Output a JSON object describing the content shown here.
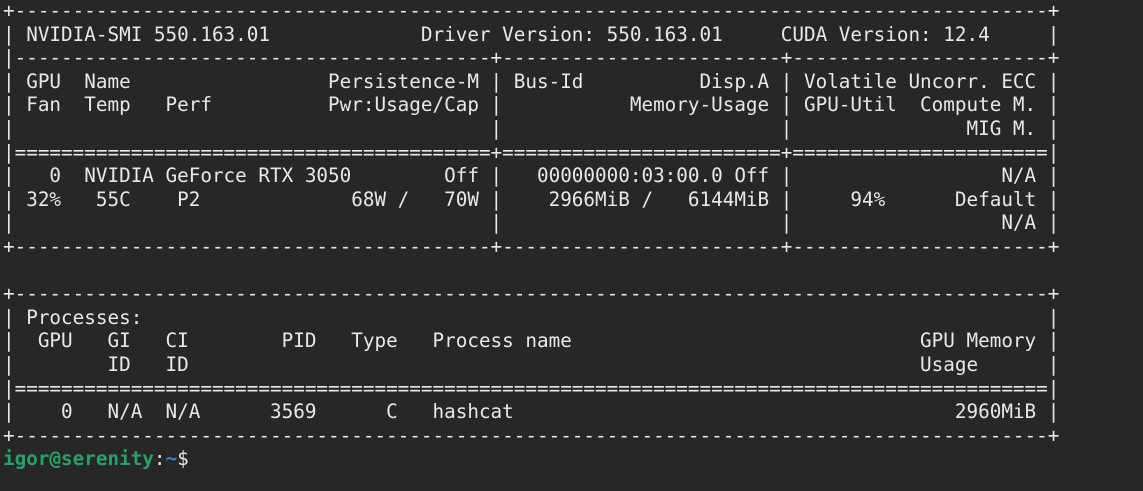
{
  "terminal": {
    "lines": [
      "+-----------------------------------------------------------------------------------------+",
      "| NVIDIA-SMI 550.163.01             Driver Version: 550.163.01     CUDA Version: 12.4     |",
      "|-----------------------------------------+------------------------+----------------------+",
      "| GPU  Name                 Persistence-M | Bus-Id          Disp.A | Volatile Uncorr. ECC |",
      "| Fan  Temp   Perf          Pwr:Usage/Cap |           Memory-Usage | GPU-Util  Compute M. |",
      "|                                         |                        |               MIG M. |",
      "|=========================================+========================+======================|",
      "|   0  NVIDIA GeForce RTX 3050        Off |   00000000:03:00.0 Off |                  N/A |",
      "| 32%   55C    P2             68W /   70W |    2966MiB /   6144MiB |     94%      Default |",
      "|                                         |                        |                  N/A |",
      "+-----------------------------------------+------------------------+----------------------+",
      "",
      "+-----------------------------------------------------------------------------------------+",
      "| Processes:                                                                              |",
      "|  GPU   GI   CI        PID   Type   Process name                              GPU Memory |",
      "|        ID   ID                                                               Usage      |",
      "|=========================================================================================|",
      "|    0   N/A  N/A      3569      C   hashcat                                      2960MiB |",
      "+-----------------------------------------------------------------------------------------+"
    ],
    "prompt": {
      "user_host": "igor@serenity",
      "separator": ":",
      "path": "~",
      "symbol": "$"
    }
  }
}
